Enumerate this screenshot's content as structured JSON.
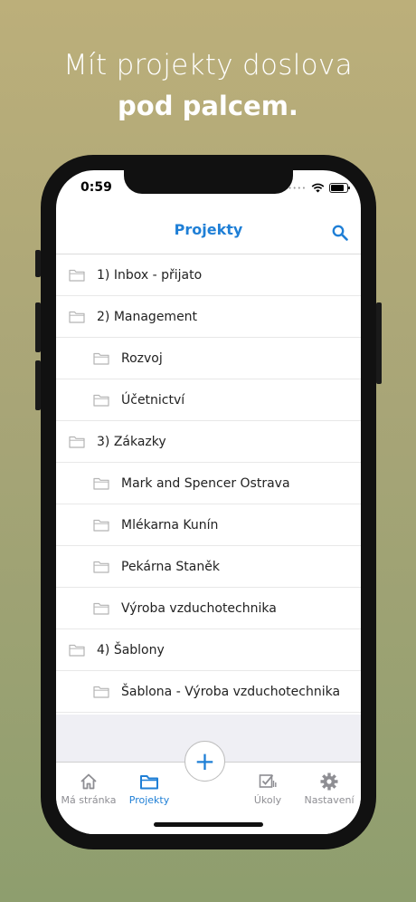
{
  "promo": {
    "line1": "Mít projekty doslova",
    "line2": "pod palcem."
  },
  "status_bar": {
    "time": "0:59",
    "dots": "••••"
  },
  "navbar": {
    "title": "Projekty",
    "search_icon": "search-icon"
  },
  "projects": [
    {
      "label": "1) Inbox - přijato",
      "level": 0
    },
    {
      "label": "2) Management",
      "level": 0
    },
    {
      "label": "Rozvoj",
      "level": 1
    },
    {
      "label": "Účetnictví",
      "level": 1
    },
    {
      "label": "3) Zákazky",
      "level": 0
    },
    {
      "label": "Mark and Spencer Ostrava",
      "level": 1
    },
    {
      "label": "Mlékarna Kunín",
      "level": 1
    },
    {
      "label": "Pekárna Staněk",
      "level": 1
    },
    {
      "label": "Výroba vzduchotechnika",
      "level": 1
    },
    {
      "label": "4) Šablony",
      "level": 0
    },
    {
      "label": "Šablona - Výroba vzduchotechnika",
      "level": 1
    }
  ],
  "tabbar": {
    "tabs": [
      {
        "label": "Má stránka",
        "icon": "home-icon"
      },
      {
        "label": "Projekty",
        "icon": "folder-icon",
        "active": true
      },
      {
        "label": "Úkoly",
        "icon": "tasks-icon"
      },
      {
        "label": "Nastavení",
        "icon": "gear-icon"
      }
    ],
    "fab_label": "+"
  },
  "colors": {
    "accent": "#1f7fd6",
    "inactive": "#8e8e93",
    "background_top": "#bcaf7a",
    "background_bottom": "#8e9e6e"
  }
}
